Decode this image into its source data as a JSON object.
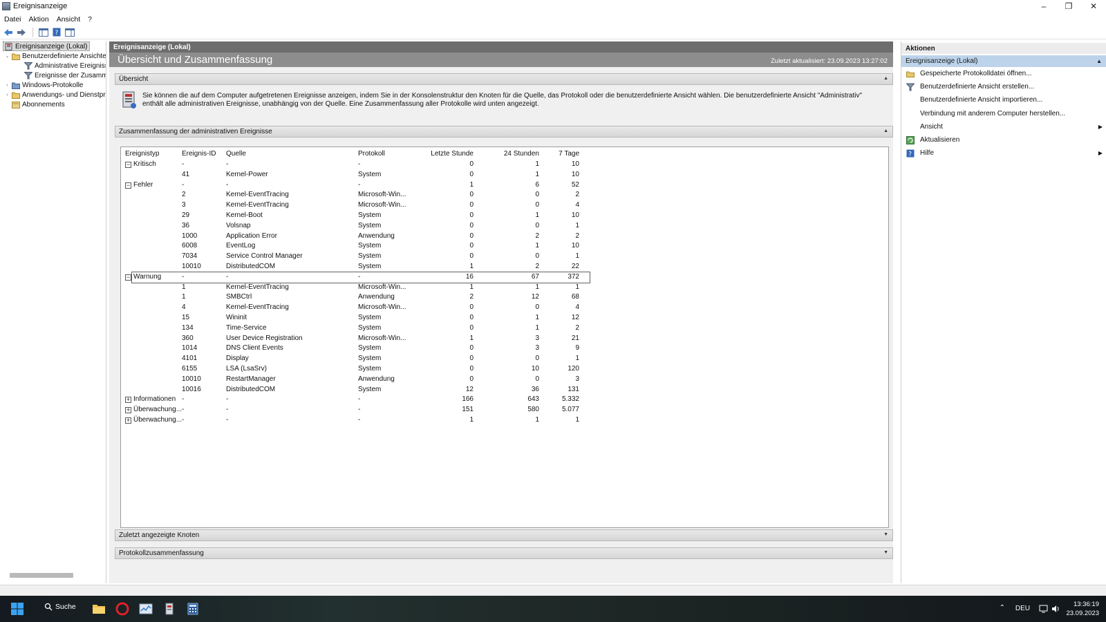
{
  "window": {
    "title": "Ereignisanzeige",
    "minimize": "–",
    "restore": "❐",
    "close": "✕"
  },
  "menu": [
    "Datei",
    "Aktion",
    "Ansicht",
    "?"
  ],
  "tree": {
    "root": "Ereignisanzeige (Lokal)",
    "custom_views": "Benutzerdefinierte Ansichten",
    "admin_events": "Administrative Ereignisse",
    "summary_events": "Ereignisse der Zusammen",
    "windows_logs": "Windows-Protokolle",
    "app_logs": "Anwendungs- und Dienstpro",
    "subscriptions": "Abonnements"
  },
  "center": {
    "header": "Ereignisanzeige (Lokal)",
    "title": "Übersicht und Zusammenfassung",
    "updated": "Zuletzt aktualisiert: 23.09.2023 13:27:02",
    "overview_label": "Übersicht",
    "overview_text": "Sie können die auf dem Computer aufgetretenen Ereignisse anzeigen, indem Sie in der Konsolenstruktur den Knoten für die Quelle, das Protokoll oder die benutzerdefinierte Ansicht wählen. Die benutzerdefinierte Ansicht \"Administrativ\" enthält alle administrativen Ereignisse, unabhängig von der Quelle. Eine Zusammenfassung aller Protokolle wird unten angezeigt.",
    "summary_label": "Zusammenfassung der administrativen Ereignisse",
    "recent_label": "Zuletzt angezeigte Knoten",
    "log_summary_label": "Protokollzusammenfassung",
    "columns": [
      "Ereignistyp",
      "Ereignis-ID",
      "Quelle",
      "Protokoll",
      "Letzte Stunde",
      "24 Stunden",
      "7 Tage"
    ],
    "rows": [
      {
        "group": "⊟",
        "typ": "Kritisch",
        "id": "-",
        "src": "-",
        "log": "-",
        "h": "0",
        "d": "1",
        "w": "10"
      },
      {
        "typ": "",
        "id": "41",
        "src": "Kernel-Power",
        "log": "System",
        "h": "0",
        "d": "1",
        "w": "10"
      },
      {
        "group": "⊟",
        "typ": "Fehler",
        "id": "-",
        "src": "-",
        "log": "-",
        "h": "1",
        "d": "6",
        "w": "52"
      },
      {
        "typ": "",
        "id": "2",
        "src": "Kernel-EventTracing",
        "log": "Microsoft-Win...",
        "h": "0",
        "d": "0",
        "w": "2"
      },
      {
        "typ": "",
        "id": "3",
        "src": "Kernel-EventTracing",
        "log": "Microsoft-Win...",
        "h": "0",
        "d": "0",
        "w": "4"
      },
      {
        "typ": "",
        "id": "29",
        "src": "Kernel-Boot",
        "log": "System",
        "h": "0",
        "d": "1",
        "w": "10"
      },
      {
        "typ": "",
        "id": "36",
        "src": "Volsnap",
        "log": "System",
        "h": "0",
        "d": "0",
        "w": "1"
      },
      {
        "typ": "",
        "id": "1000",
        "src": "Application Error",
        "log": "Anwendung",
        "h": "0",
        "d": "2",
        "w": "2"
      },
      {
        "typ": "",
        "id": "6008",
        "src": "EventLog",
        "log": "System",
        "h": "0",
        "d": "1",
        "w": "10"
      },
      {
        "typ": "",
        "id": "7034",
        "src": "Service Control Manager",
        "log": "System",
        "h": "0",
        "d": "0",
        "w": "1"
      },
      {
        "typ": "",
        "id": "10010",
        "src": "DistributedCOM",
        "log": "System",
        "h": "1",
        "d": "2",
        "w": "22"
      },
      {
        "group": "⊟",
        "typ": "Warnung",
        "id": "-",
        "src": "-",
        "log": "-",
        "h": "16",
        "d": "67",
        "w": "372",
        "selected": true
      },
      {
        "typ": "",
        "id": "1",
        "src": "Kernel-EventTracing",
        "log": "Microsoft-Win...",
        "h": "1",
        "d": "1",
        "w": "1"
      },
      {
        "typ": "",
        "id": "1",
        "src": "SMBCtrl",
        "log": "Anwendung",
        "h": "2",
        "d": "12",
        "w": "68"
      },
      {
        "typ": "",
        "id": "4",
        "src": "Kernel-EventTracing",
        "log": "Microsoft-Win...",
        "h": "0",
        "d": "0",
        "w": "4"
      },
      {
        "typ": "",
        "id": "15",
        "src": "Wininit",
        "log": "System",
        "h": "0",
        "d": "1",
        "w": "12"
      },
      {
        "typ": "",
        "id": "134",
        "src": "Time-Service",
        "log": "System",
        "h": "0",
        "d": "1",
        "w": "2"
      },
      {
        "typ": "",
        "id": "360",
        "src": "User Device Registration",
        "log": "Microsoft-Win...",
        "h": "1",
        "d": "3",
        "w": "21"
      },
      {
        "typ": "",
        "id": "1014",
        "src": "DNS Client Events",
        "log": "System",
        "h": "0",
        "d": "3",
        "w": "9"
      },
      {
        "typ": "",
        "id": "4101",
        "src": "Display",
        "log": "System",
        "h": "0",
        "d": "0",
        "w": "1"
      },
      {
        "typ": "",
        "id": "6155",
        "src": "LSA (LsaSrv)",
        "log": "System",
        "h": "0",
        "d": "10",
        "w": "120"
      },
      {
        "typ": "",
        "id": "10010",
        "src": "RestartManager",
        "log": "Anwendung",
        "h": "0",
        "d": "0",
        "w": "3"
      },
      {
        "typ": "",
        "id": "10016",
        "src": "DistributedCOM",
        "log": "System",
        "h": "12",
        "d": "36",
        "w": "131"
      },
      {
        "group": "⊞",
        "typ": "Informationen",
        "id": "-",
        "src": "-",
        "log": "-",
        "h": "166",
        "d": "643",
        "w": "5.332"
      },
      {
        "group": "⊞",
        "typ": "Überwachung...",
        "id": "-",
        "src": "-",
        "log": "-",
        "h": "151",
        "d": "580",
        "w": "5.077"
      },
      {
        "group": "⊞",
        "typ": "Überwachung...",
        "id": "-",
        "src": "-",
        "log": "-",
        "h": "1",
        "d": "1",
        "w": "1"
      }
    ]
  },
  "actions": {
    "header": "Aktionen",
    "group": "Ereignisanzeige (Lokal)",
    "items": [
      {
        "label": "Gespeicherte Protokolldatei öffnen...",
        "icon": "folder-icon"
      },
      {
        "label": "Benutzerdefinierte Ansicht erstellen...",
        "icon": "filter-icon"
      },
      {
        "label": "Benutzerdefinierte Ansicht importieren...",
        "icon": ""
      },
      {
        "label": "Verbindung mit anderem Computer herstellen...",
        "icon": ""
      },
      {
        "label": "Ansicht",
        "icon": "",
        "submenu": true
      },
      {
        "label": "Aktualisieren",
        "icon": "refresh-icon"
      },
      {
        "label": "Hilfe",
        "icon": "help-icon",
        "submenu": true
      }
    ]
  },
  "taskbar": {
    "search": "Suche",
    "lang": "DEU",
    "time": "13:36:19",
    "date": "23.09.2023"
  }
}
